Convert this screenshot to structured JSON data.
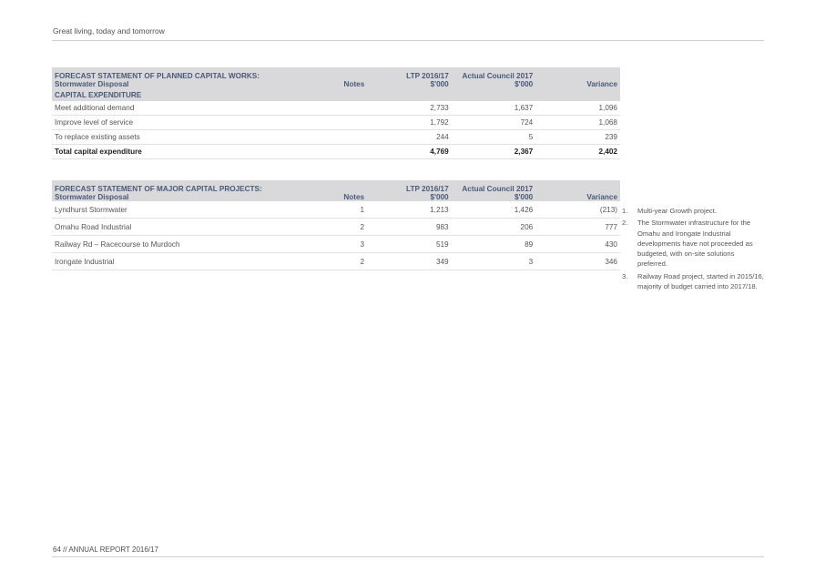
{
  "header": {
    "text": "Great living, today and tomorrow"
  },
  "footer": {
    "text": "64 // ANNUAL REPORT 2016/17"
  },
  "table1": {
    "title": "FORECAST STATEMENT OF PLANNED CAPITAL WORKS:",
    "subtitle": "Stormwater Disposal",
    "col_notes": "Notes",
    "col_ltp_1": "LTP 2016/17",
    "col_ltp_2": "$'000",
    "col_actual_1": "Actual Council 2017",
    "col_actual_2": "$'000",
    "col_variance": "Variance",
    "section": "CAPITAL EXPENDITURE",
    "rows": [
      {
        "desc": "Meet additional demand",
        "notes": "",
        "ltp": "2,733",
        "actual": "1,637",
        "variance": "1,096"
      },
      {
        "desc": "Improve level of service",
        "notes": "",
        "ltp": "1,792",
        "actual": "724",
        "variance": "1,068"
      },
      {
        "desc": "To replace existing assets",
        "notes": "",
        "ltp": "244",
        "actual": "5",
        "variance": "239"
      }
    ],
    "total": {
      "desc": "Total capital expenditure",
      "ltp": "4,769",
      "actual": "2,367",
      "variance": "2,402"
    }
  },
  "table2": {
    "title": "FORECAST STATEMENT OF MAJOR CAPITAL PROJECTS:",
    "subtitle": "Stormwater Disposal",
    "col_notes": "Notes",
    "col_ltp_1": "LTP 2016/17",
    "col_ltp_2": "$'000",
    "col_actual_1": "Actual Council 2017",
    "col_actual_2": "$'000",
    "col_variance": "Variance",
    "rows": [
      {
        "desc": "Lyndhurst Stormwater",
        "notes": "1",
        "ltp": "1,213",
        "actual": "1,426",
        "variance": "(213)"
      },
      {
        "desc": "Omahu Road Industrial",
        "notes": "2",
        "ltp": "983",
        "actual": "206",
        "variance": "777"
      },
      {
        "desc": "Railway Rd – Racecourse to Murdoch",
        "notes": "3",
        "ltp": "519",
        "actual": "89",
        "variance": "430"
      },
      {
        "desc": "Irongate Industrial",
        "notes": "2",
        "ltp": "349",
        "actual": "3",
        "variance": "346"
      }
    ]
  },
  "notes": [
    {
      "num": "1.",
      "text": "Multi-year Growth project."
    },
    {
      "num": "2.",
      "text": "The Stormwater infrastructure for the Omahu and Irongate Industrial developments have not proceeded as budgeted, with on-site solutions preferred."
    },
    {
      "num": "3.",
      "text": "Railway Road project, started in 2015/16, majority of budget carried into 2017/18."
    }
  ]
}
